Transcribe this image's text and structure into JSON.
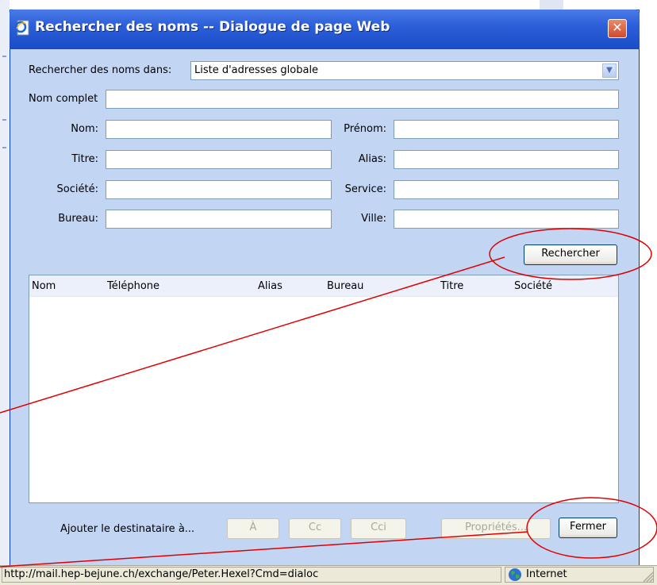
{
  "window": {
    "title": "Rechercher des noms -- Dialogue de page Web",
    "close_symbol": "✕",
    "icon": "ie-page-icon"
  },
  "search": {
    "scope_label": "Rechercher des noms dans:",
    "scope_value": "Liste d'adresses globale",
    "fullname_label": "Nom complet",
    "fullname_value": "",
    "fields": {
      "nom": {
        "label": "Nom:",
        "value": ""
      },
      "prenom": {
        "label": "Prénom:",
        "value": ""
      },
      "titre": {
        "label": "Titre:",
        "value": ""
      },
      "alias": {
        "label": "Alias:",
        "value": ""
      },
      "societe": {
        "label": "Société:",
        "value": ""
      },
      "service": {
        "label": "Service:",
        "value": ""
      },
      "bureau": {
        "label": "Bureau:",
        "value": ""
      },
      "ville": {
        "label": "Ville:",
        "value": ""
      }
    },
    "search_button": "Rechercher"
  },
  "results": {
    "columns": [
      "Nom",
      "Téléphone",
      "Alias",
      "Bureau",
      "Titre",
      "Société"
    ],
    "rows": []
  },
  "footer": {
    "add_label": "Ajouter le destinataire à...",
    "to_button": "À",
    "cc_button": "Cc",
    "bcc_button": "Cci",
    "properties_button": "Propriétés...",
    "close_button": "Fermer"
  },
  "statusbar": {
    "url": "http://mail.hep-bejune.ch/exchange/Peter.Hexel?Cmd=dialoc",
    "zone": "Internet"
  },
  "colors": {
    "dialog_bg": "#c2d5f3",
    "titlebar": "#2d5fd9",
    "annotation": "#e00000"
  }
}
